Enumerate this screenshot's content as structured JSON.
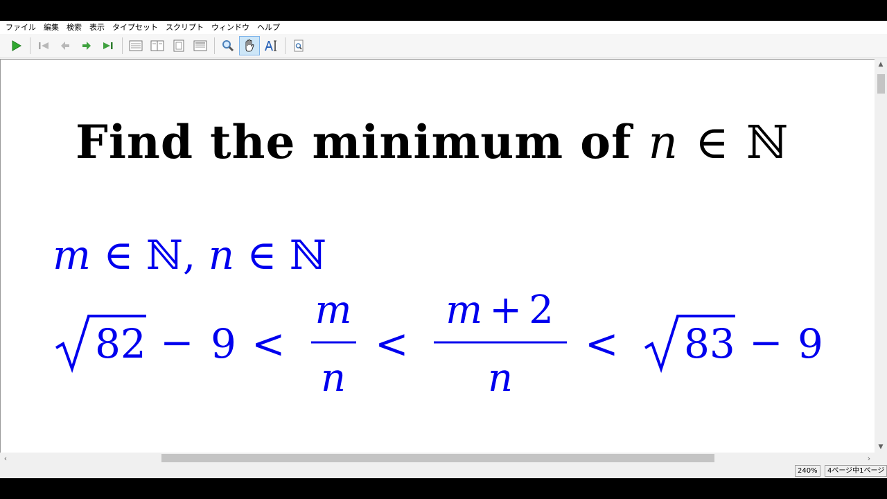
{
  "menu": [
    "ファイル",
    "編集",
    "検索",
    "表示",
    "タイプセット",
    "スクリプト",
    "ウィンドウ",
    "ヘルプ"
  ],
  "toolbar": {
    "icons": [
      "typeset-play-icon",
      "go-first-page-icon",
      "go-previous-page-icon",
      "go-next-page-icon",
      "go-last-page-icon",
      "single-page-view-icon",
      "two-page-view-icon",
      "fit-page-icon",
      "fit-width-icon",
      "magnifier-icon",
      "hand-tool-icon",
      "text-select-icon",
      "find-icon"
    ],
    "active": "hand-tool-icon"
  },
  "document": {
    "title_words": "Find the minimum of",
    "title_var": "n",
    "member_symbol": "∈",
    "naturals_symbol": "ℕ",
    "line2": {
      "var1": "m",
      "var2": "n"
    },
    "inequality": {
      "sqrt1_radicand": "82",
      "sqrt2_radicand": "83",
      "minus": "−",
      "nine": "9",
      "less": "<",
      "frac1_num": "m",
      "frac1_den": "n",
      "frac2_num_var": "m",
      "frac2_num_plus": "+",
      "frac2_num_const": "2",
      "frac2_den": "n"
    }
  },
  "status": {
    "zoom": "240%",
    "page": "4ページ中1ページ"
  },
  "colors": {
    "math_blue": "#0000ee",
    "text_black": "#000000"
  }
}
